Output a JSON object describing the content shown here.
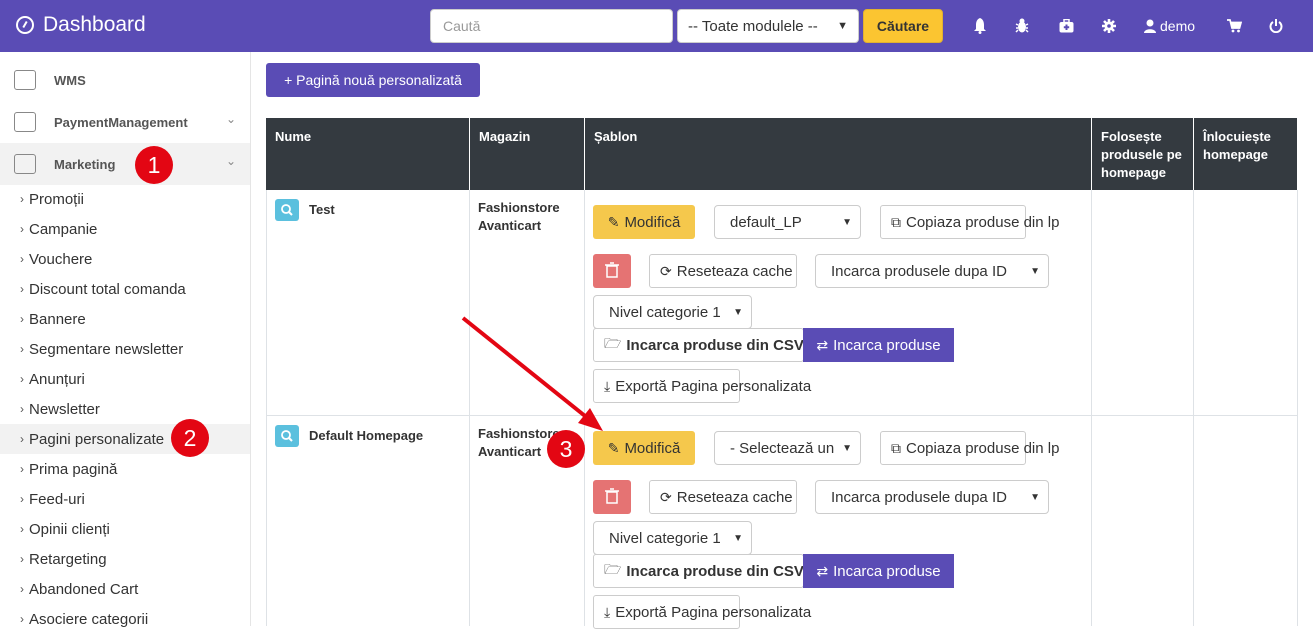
{
  "header": {
    "title": "Dashboard",
    "search_placeholder": "Caută",
    "module_select": "-- Toate modulele --",
    "search_button": "Căutare",
    "user": "demo"
  },
  "colors": {
    "header_bg": "#5a4cb5",
    "accent_yellow": "#f5c84c",
    "delete_red": "#e57373",
    "info_blue": "#5bc0de",
    "table_header": "#343a40",
    "badge_red": "#e30613"
  },
  "sidebar": {
    "sections": [
      {
        "label": "WMS",
        "icon": "warehouse-icon"
      },
      {
        "label": "PaymentManagement",
        "icon": "payment-icon"
      },
      {
        "label": "Marketing",
        "icon": "marketing-icon"
      }
    ],
    "items": [
      "Promoții",
      "Campanie",
      "Vouchere",
      "Discount total comanda",
      "Bannere",
      "Segmentare newsletter",
      "Anunțuri",
      "Newsletter",
      "Pagini personalizate",
      "Prima pagină",
      "Feed-uri",
      "Opinii clienți",
      "Retargeting",
      "Abandoned Cart",
      "Asociere categorii"
    ]
  },
  "annotations": [
    "1",
    "2",
    "3"
  ],
  "main": {
    "new_page_button": "+ Pagină nouă personalizată",
    "table": {
      "headers": [
        "Nume",
        "Magazin",
        "Șablon",
        "Folosește produsele pe homepage",
        "Înlocuiește homepage"
      ],
      "rows": [
        {
          "name": "Test",
          "store_line1": "Fashionstore",
          "store_line2": "Avanticart",
          "template_value": "default_LP",
          "modify": "Modifică",
          "copy_products": "Copiaza produse din lp",
          "reset_cache": "Reseteaza cache",
          "load_by": "Incarca produsele dupa ID",
          "level": "Nivel categorie 1",
          "load_csv": "Incarca produse din CSV",
          "load_products": "Incarca produse",
          "export": "Exportă Pagina personalizata"
        },
        {
          "name": "Default Homepage",
          "store_line1": "Fashionstore",
          "store_line2": "Avanticart",
          "template_value": "- Selectează un",
          "modify": "Modifică",
          "copy_products": "Copiaza produse din lp",
          "reset_cache": "Reseteaza cache",
          "load_by": "Incarca produsele dupa ID",
          "level": "Nivel categorie 1",
          "load_csv": "Incarca produse din CSV",
          "load_products": "Incarca produse",
          "export": "Exportă Pagina personalizata"
        }
      ]
    }
  }
}
